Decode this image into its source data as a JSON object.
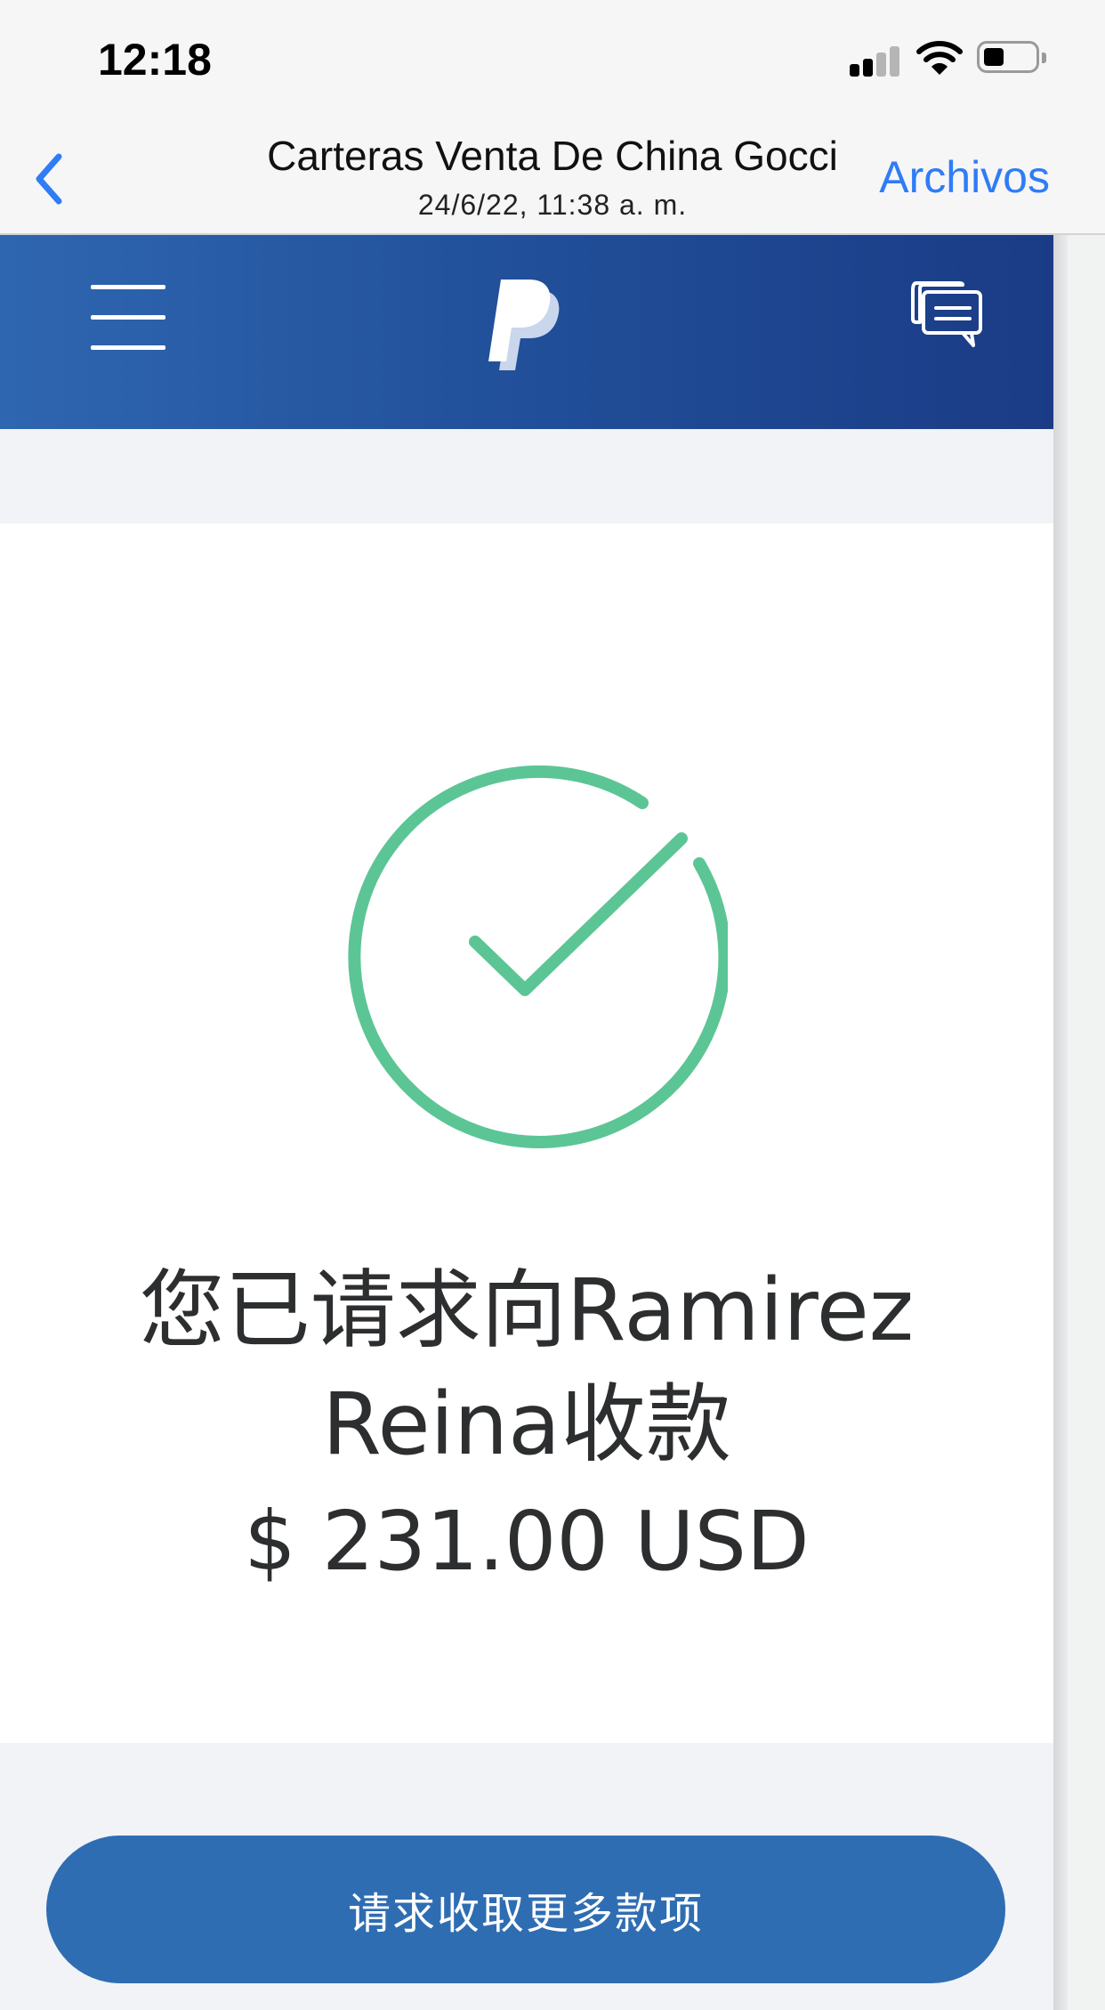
{
  "status_bar": {
    "time": "12:18",
    "icons": [
      "signal-icon",
      "wifi-icon",
      "battery-icon"
    ]
  },
  "nav": {
    "back_icon": "chevron-left-icon",
    "title": "Carteras Venta De China Gocci",
    "subtitle": "24/6/22, 11:38 a. m.",
    "files_label": "Archivos",
    "accent_color": "#2f7cf6"
  },
  "paypal": {
    "header_icons": [
      "menu-icon",
      "paypal-logo-icon",
      "chat-icon"
    ],
    "brand_color": "#214f99",
    "success_icon": "check-circle-icon",
    "success_color": "#5cc595",
    "message_line1": "您已请求向Ramirez",
    "message_line2": "Reina收款",
    "amount": "$ 231.00 USD",
    "button_label": "请求收取更多款项",
    "button_color": "#2f6db3"
  }
}
